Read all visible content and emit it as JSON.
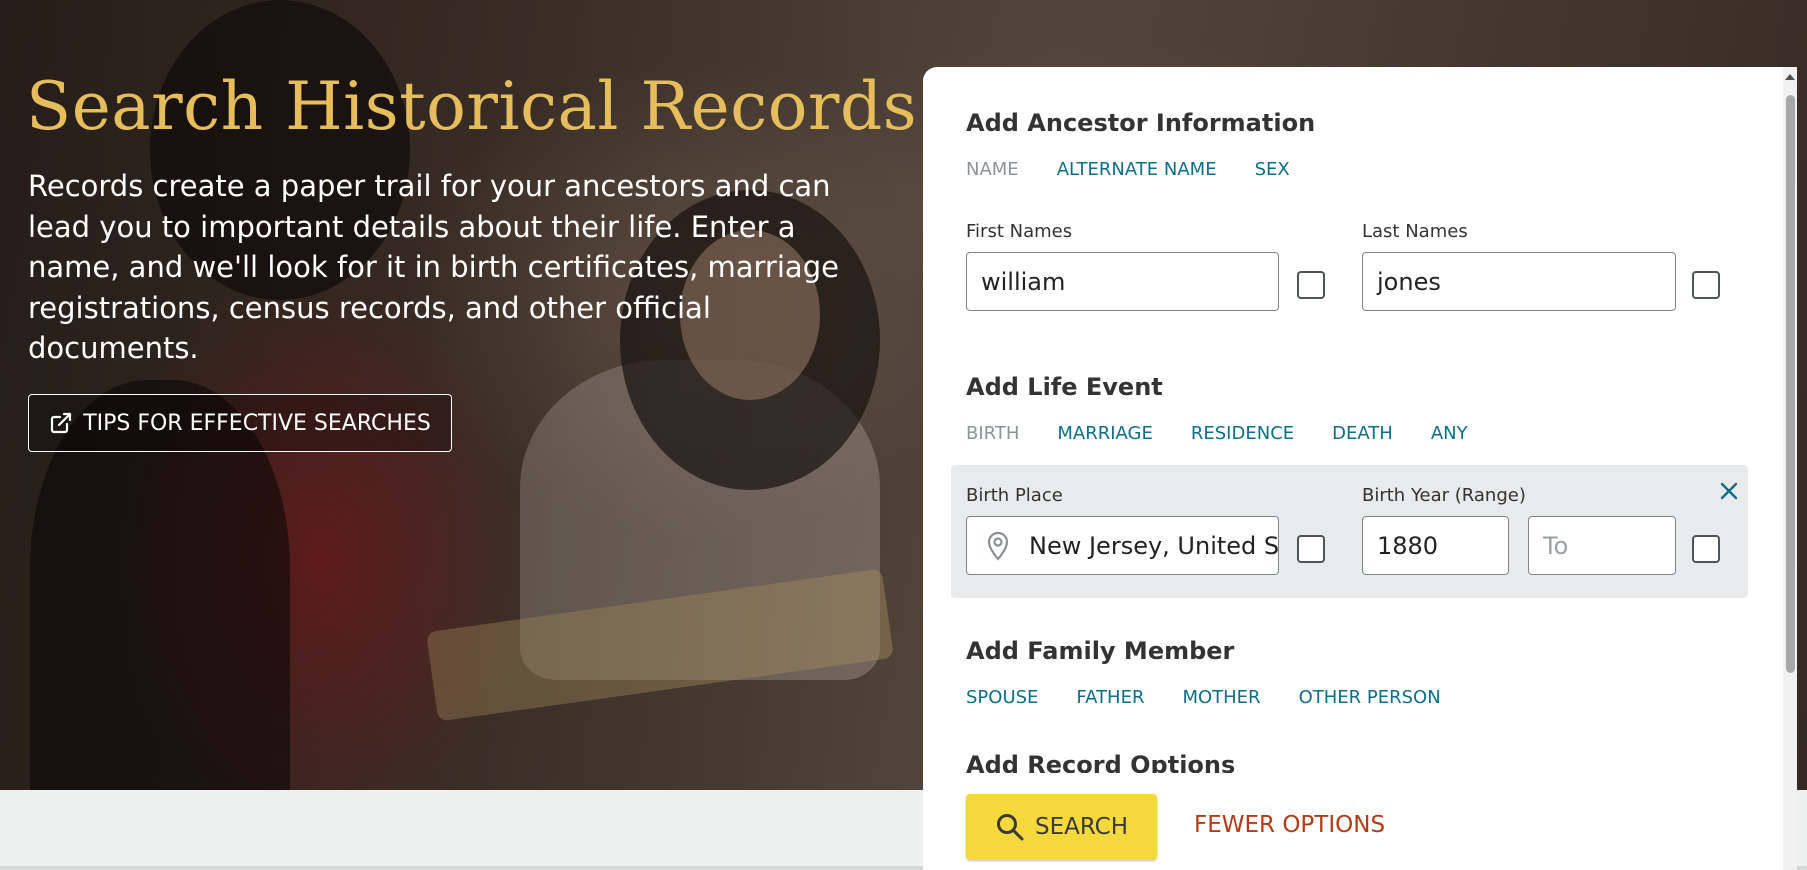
{
  "hero": {
    "title": "Search Historical Records",
    "description": "Records create a paper trail for your ancestors and can lead you to important details about their life. Enter a name, and we'll look for it in birth certificates, marriage registrations, census records, and other official documents.",
    "tips_button_label": "TIPS FOR EFFECTIVE SEARCHES",
    "tips_icon": "external-link-icon"
  },
  "ancestor": {
    "heading": "Add Ancestor Information",
    "tabs": [
      {
        "label": "NAME",
        "active": true
      },
      {
        "label": "ALTERNATE NAME",
        "active": false
      },
      {
        "label": "SEX",
        "active": false
      }
    ],
    "first_names": {
      "label": "First Names",
      "value": "william",
      "exact": false
    },
    "last_names": {
      "label": "Last Names",
      "value": "jones",
      "exact": false
    }
  },
  "life_event": {
    "heading": "Add Life Event",
    "tabs": [
      {
        "label": "BIRTH",
        "active": true
      },
      {
        "label": "MARRIAGE",
        "active": false
      },
      {
        "label": "RESIDENCE",
        "active": false
      },
      {
        "label": "DEATH",
        "active": false
      },
      {
        "label": "ANY",
        "active": false
      }
    ],
    "birth_place": {
      "label": "Birth Place",
      "value": "New Jersey, United States",
      "icon": "location-pin-icon",
      "exact": false
    },
    "birth_year": {
      "label": "Birth Year (Range)",
      "from_value": "1880",
      "to_placeholder": "To",
      "exact": false
    },
    "remove_icon": "close-icon"
  },
  "family": {
    "heading": "Add Family Member",
    "tabs": [
      {
        "label": "SPOUSE"
      },
      {
        "label": "FATHER"
      },
      {
        "label": "MOTHER"
      },
      {
        "label": "OTHER PERSON"
      }
    ]
  },
  "record_options": {
    "heading": "Add Record Options"
  },
  "actions": {
    "search_label": "SEARCH",
    "search_icon": "search-icon",
    "fewer_options_label": "FEWER OPTIONS"
  },
  "colors": {
    "title_gold": "#e6bd5c",
    "link_teal": "#0d6e8a",
    "search_yellow": "#f5d93c",
    "fewer_options_red": "#b33c14"
  }
}
